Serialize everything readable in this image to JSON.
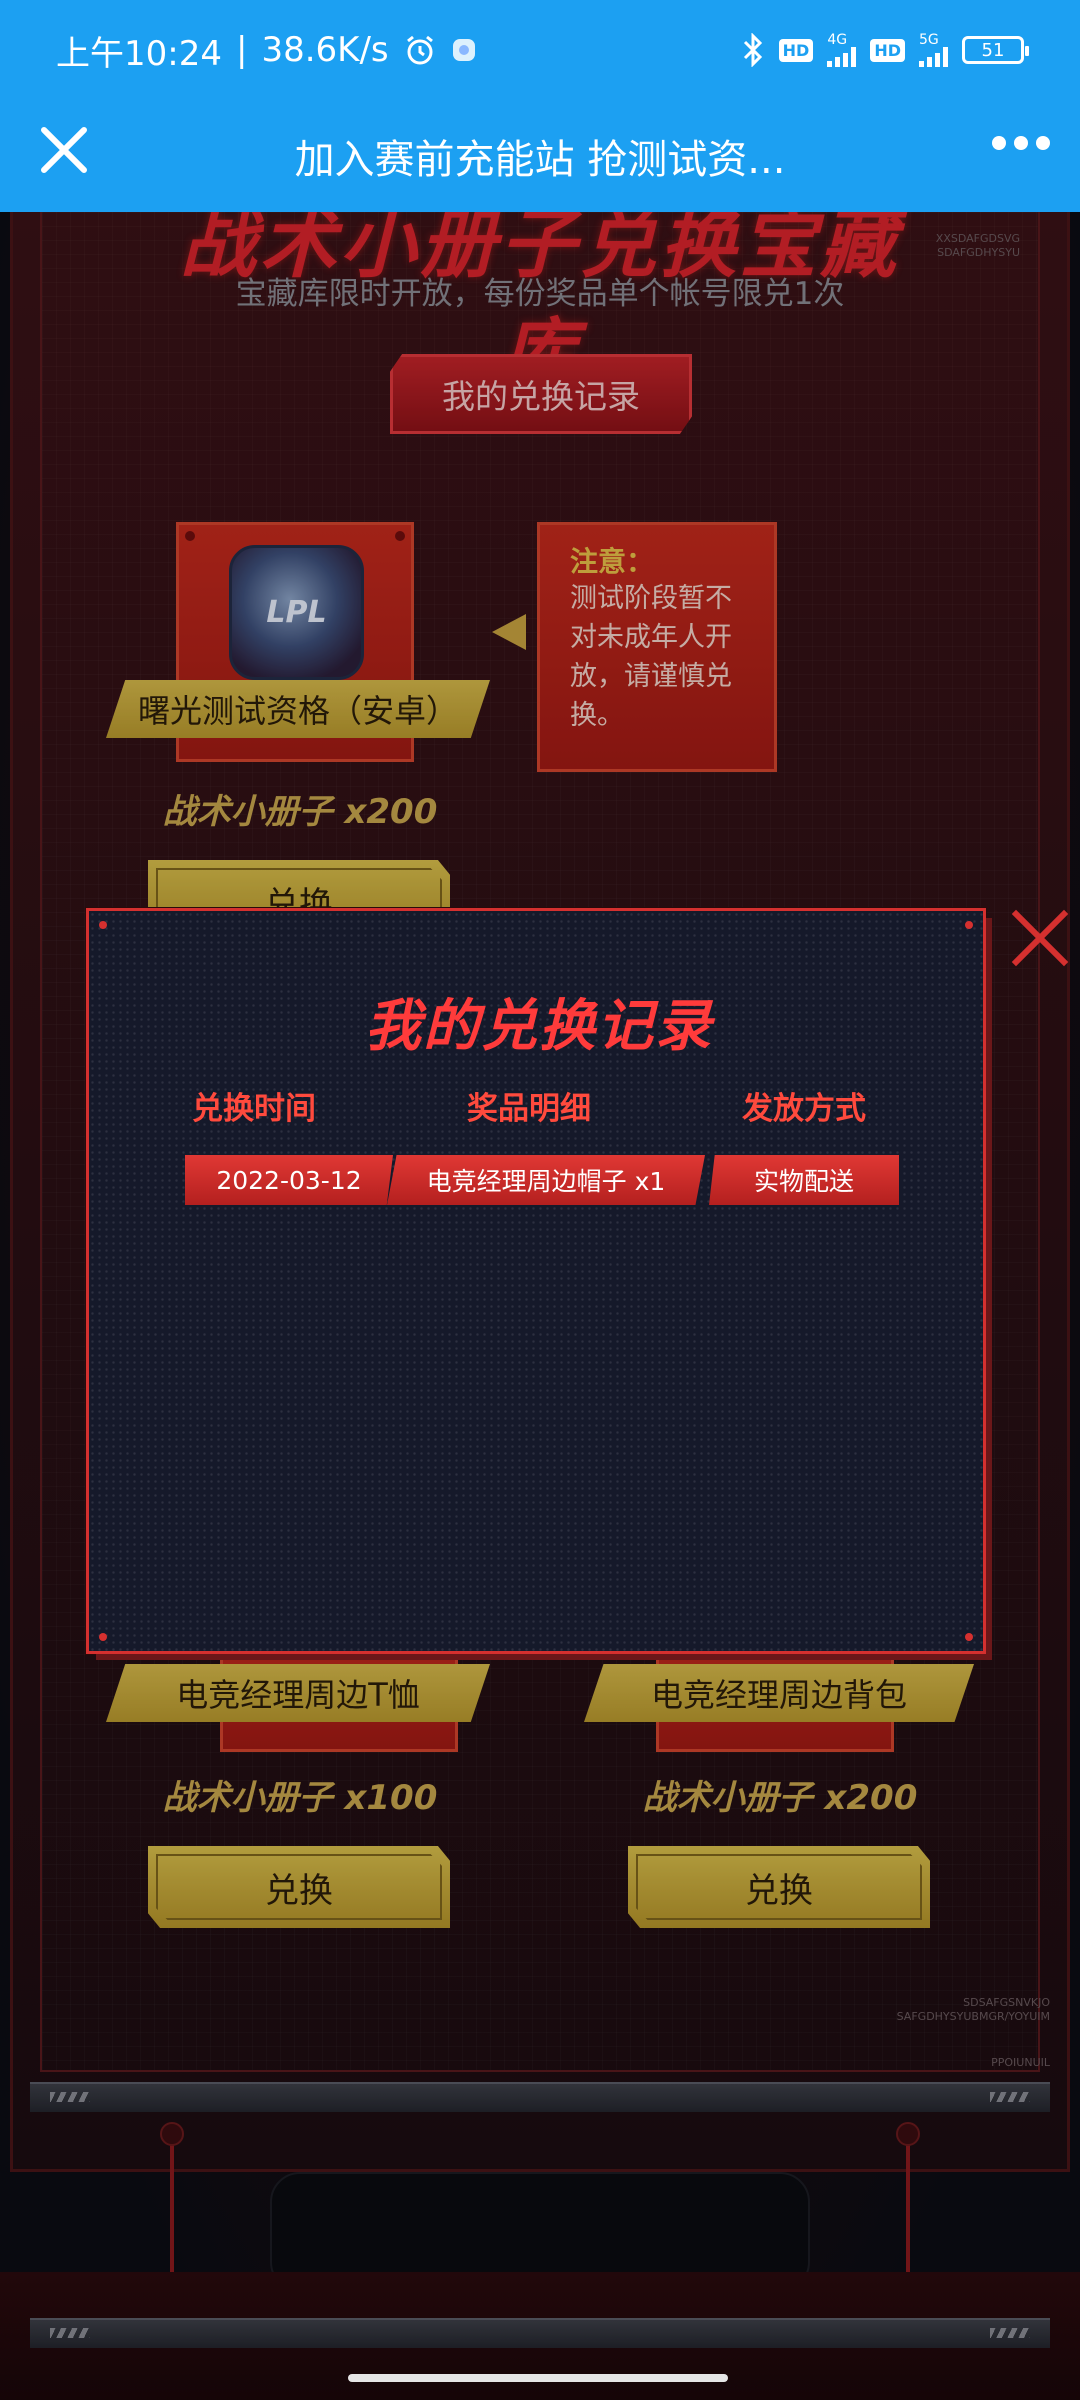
{
  "status_bar": {
    "time": "上午10:24",
    "net_speed": "38.6K/s",
    "net_4g": "4G",
    "net_5g": "5G",
    "hd": "HD",
    "battery": "51"
  },
  "titlebar": {
    "title": "加入赛前充能站 抢测试资..."
  },
  "background": {
    "treasury_title": "战术小册子兑换宝藏库",
    "treasury_subtitle": "宝藏库限时开放，每份奖品单个帐号限兑1次",
    "side_text_top": "XXSDAFGDSVG\nSDAFGDHYSYU",
    "side_text_bottom": "SDSAFGSNVKJO\nSAFGDHYSYUBMGR/YOYUIM",
    "side_text_bottom2": "PPOIUNUIL",
    "my_records_button": "我的兑换记录",
    "prizes": [
      {
        "name": "曙光测试资格（安卓）",
        "cost": "战术小册子 x200",
        "button": "兑换",
        "img_text": "LPL"
      },
      {
        "name": "电竞经理周边T恤",
        "cost": "战术小册子 x100",
        "button": "兑换"
      },
      {
        "name": "电竞经理周边背包",
        "cost": "战术小册子 x200",
        "button": "兑换"
      }
    ],
    "notice": {
      "title": "注意：",
      "body": "测试阶段暂不对未成年人开放，请谨慎兑换。"
    }
  },
  "modal": {
    "title": "我的兑换记录",
    "columns": [
      "兑换时间",
      "奖品明细",
      "发放方式"
    ],
    "rows": [
      {
        "time": "2022-03-12",
        "item": "电竞经理周边帽子 x1",
        "method": "实物配送"
      }
    ]
  },
  "colors": {
    "titlebar": "#1ca0f2",
    "modal_border": "#d5302f",
    "accent_red": "#ff3b3b",
    "gold": "#c8a64e"
  }
}
